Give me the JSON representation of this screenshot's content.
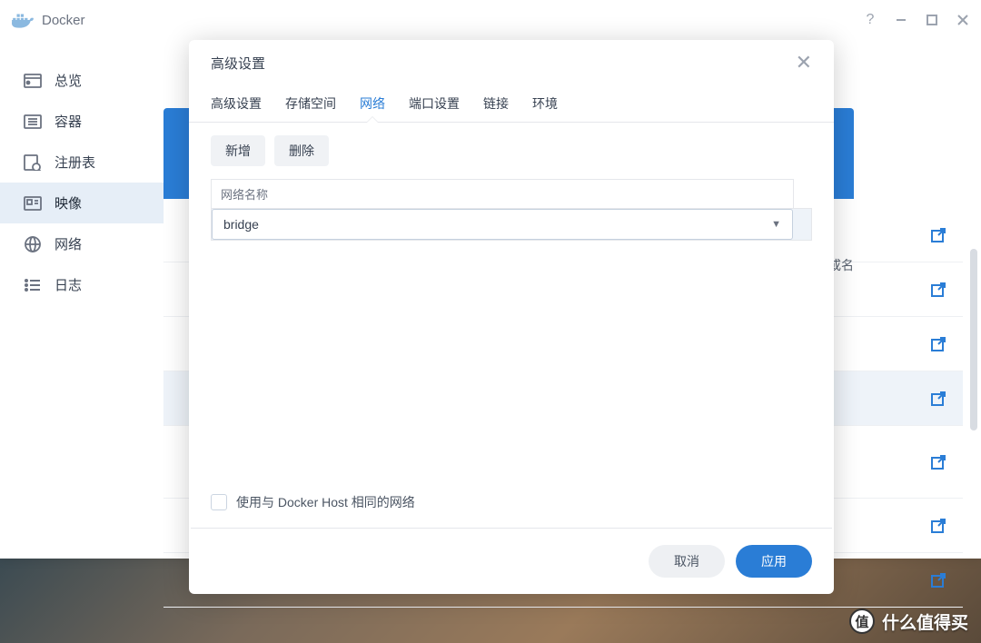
{
  "titlebar": {
    "title": "Docker"
  },
  "sidebar": {
    "items": [
      {
        "label": "总览"
      },
      {
        "label": "容器"
      },
      {
        "label": "注册表"
      },
      {
        "label": "映像"
      },
      {
        "label": "网络"
      },
      {
        "label": "日志"
      }
    ]
  },
  "background": {
    "alias_text": "或名"
  },
  "modal": {
    "title": "高级设置",
    "tabs": [
      {
        "label": "高级设置"
      },
      {
        "label": "存储空间"
      },
      {
        "label": "网络"
      },
      {
        "label": "端口设置"
      },
      {
        "label": "链接"
      },
      {
        "label": "环境"
      }
    ],
    "toolbar": {
      "add": "新增",
      "delete": "删除"
    },
    "table": {
      "header": "网络名称",
      "selected_value": "bridge"
    },
    "checkbox_label": "使用与 Docker Host 相同的网络",
    "cancel": "取消",
    "apply": "应用"
  },
  "watermark": {
    "char": "值",
    "text": "什么值得买"
  }
}
